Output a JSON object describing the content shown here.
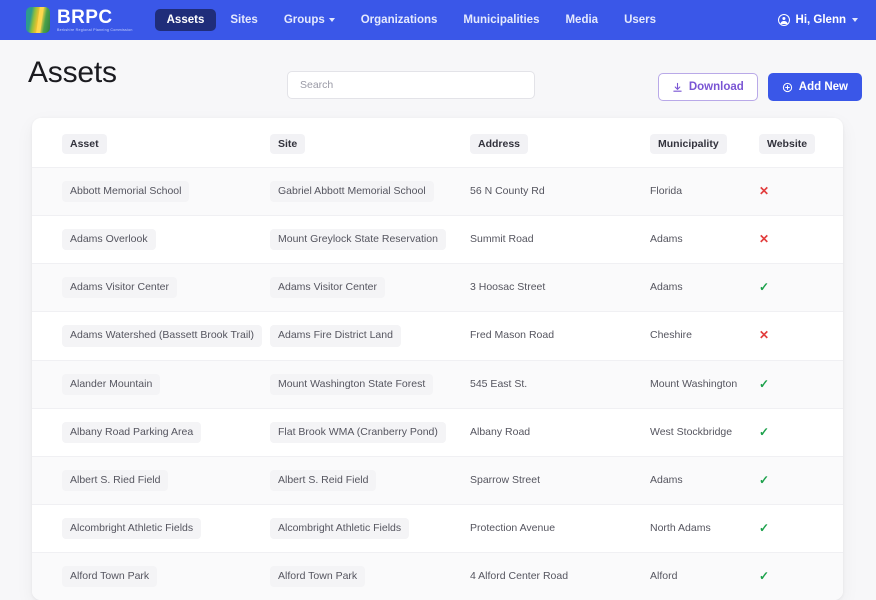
{
  "navbar": {
    "brand": {
      "title": "BRPC",
      "subtitle": "Berkshire Regional Planning Commission",
      "icon": "brpc-logo-icon"
    },
    "items": [
      {
        "label": "Assets",
        "active": true,
        "dropdown": false
      },
      {
        "label": "Sites",
        "active": false,
        "dropdown": false
      },
      {
        "label": "Groups",
        "active": false,
        "dropdown": true
      },
      {
        "label": "Organizations",
        "active": false,
        "dropdown": false
      },
      {
        "label": "Municipalities",
        "active": false,
        "dropdown": false
      },
      {
        "label": "Media",
        "active": false,
        "dropdown": false
      },
      {
        "label": "Users",
        "active": false,
        "dropdown": false
      }
    ],
    "user_greeting": "Hi, Glenn",
    "user_icon": "user-circle-icon",
    "bg_color": "#3a57e8",
    "active_item_color": "#1f2d7a"
  },
  "page": {
    "title": "Assets"
  },
  "search": {
    "placeholder": "Search",
    "value": ""
  },
  "actions": {
    "download_label": "Download",
    "download_icon": "download-icon",
    "add_label": "Add New",
    "add_icon": "plus-circle-icon",
    "download_color": "#7a55d4",
    "add_color": "#3a57e8"
  },
  "table": {
    "columns": [
      "Asset",
      "Site",
      "Address",
      "Municipality",
      "Website"
    ],
    "website_yes_icon": "check-icon",
    "website_no_icon": "cross-icon",
    "yes_color": "#1ca14b",
    "no_color": "#e23c3c",
    "rows": [
      {
        "asset": "Abbott Memorial School",
        "site": "Gabriel Abbott Memorial School",
        "address": "56 N County Rd",
        "municipality": "Florida",
        "website": "no"
      },
      {
        "asset": "Adams Overlook",
        "site": "Mount Greylock State Reservation",
        "address": "Summit Road",
        "municipality": "Adams",
        "website": "no"
      },
      {
        "asset": "Adams Visitor Center",
        "site": "Adams Visitor Center",
        "address": "3 Hoosac Street",
        "municipality": "Adams",
        "website": "yes"
      },
      {
        "asset": "Adams Watershed (Bassett Brook Trail)",
        "site": "Adams Fire District Land",
        "address": "Fred Mason Road",
        "municipality": "Cheshire",
        "website": "no"
      },
      {
        "asset": "Alander Mountain",
        "site": "Mount Washington State Forest",
        "address": "545 East St.",
        "municipality": "Mount Washington",
        "website": "yes"
      },
      {
        "asset": "Albany Road Parking Area",
        "site": "Flat Brook WMA (Cranberry Pond)",
        "address": "Albany Road",
        "municipality": "West Stockbridge",
        "website": "yes"
      },
      {
        "asset": "Albert S. Ried Field",
        "site": "Albert S. Reid Field",
        "address": "Sparrow Street",
        "municipality": "Adams",
        "website": "yes"
      },
      {
        "asset": "Alcombright Athletic Fields",
        "site": "Alcombright Athletic Fields",
        "address": "Protection Avenue",
        "municipality": "North Adams",
        "website": "yes"
      },
      {
        "asset": "Alford Town Park",
        "site": "Alford Town Park",
        "address": "4 Alford Center Road",
        "municipality": "Alford",
        "website": "yes"
      }
    ]
  }
}
